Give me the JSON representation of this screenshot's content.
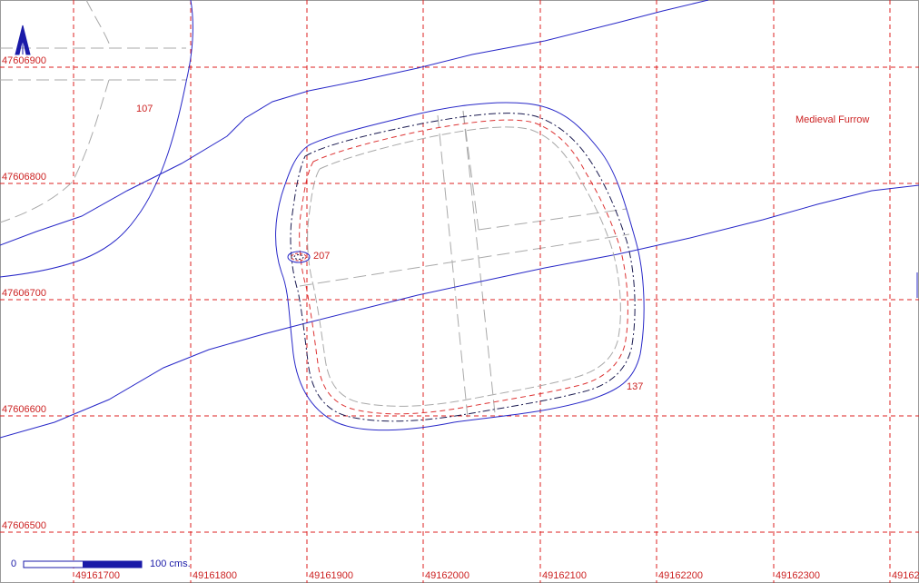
{
  "map": {
    "colors": {
      "grid": "#dd2222",
      "contour": "#2828c8",
      "feature_grey": "#a9a9a9",
      "label": "#cc2222",
      "scale": "#1a1aa8"
    },
    "grid": {
      "x_labels": [
        "49161700",
        "49161800",
        "49161900",
        "49162000",
        "49162100",
        "49162200",
        "49162300",
        "49162"
      ],
      "y_labels": [
        "47606900",
        "47606800",
        "47606700",
        "47606600",
        "47606500"
      ]
    },
    "annotations": {
      "feature_107": "107",
      "feature_207": "207",
      "feature_137": "137",
      "medieval_furrow": "Medieval Furrow"
    },
    "scale_bar": {
      "start_label": "0",
      "end_label": "100 cms."
    },
    "north_arrow": {
      "icon": "north-arrow-icon"
    }
  }
}
